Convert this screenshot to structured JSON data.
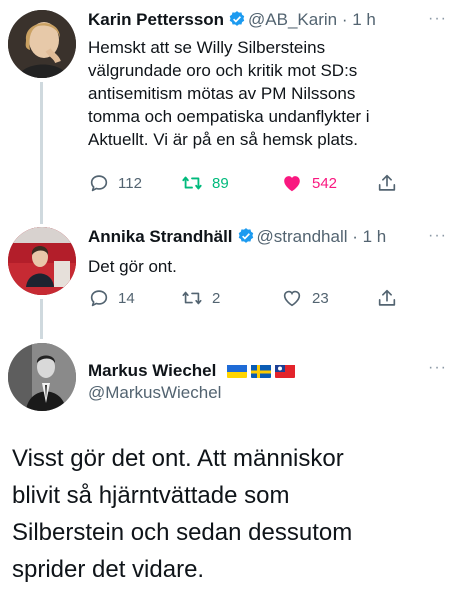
{
  "tweets": [
    {
      "name": "Karin Pettersson",
      "handle": "@AB_Karin",
      "time": "· 1 h",
      "text_lines": [
        "Hemskt att se Willy Silbersteins",
        "välgrundade oro och kritik mot SD:s",
        "antisemitism mötas av PM Nilssons",
        "tomma och oempatiska undanflykter i",
        "Aktuellt. Vi är på en så hemsk plats."
      ],
      "replies": "112",
      "retweets": "89",
      "likes": "542"
    },
    {
      "name": "Annika Strandhäll",
      "handle": "@strandhall",
      "time": "· 1 h",
      "text_lines": [
        "Det gör ont."
      ],
      "replies": "14",
      "retweets": "2",
      "likes": "23"
    },
    {
      "name": "Markus Wiechel",
      "handle": "@MarkusWiechel",
      "flags": [
        "ukraine-flag",
        "sweden-flag",
        "taiwan-flag"
      ],
      "text_lines": [
        "Visst gör det ont. Att människor",
        "blivit så hjärntvättade som",
        "Silberstein och sedan dessutom",
        "sprider det vidare."
      ]
    }
  ],
  "more_label": "···",
  "colors": {
    "like_active": "#f91880",
    "retweet_active": "#00ba7c",
    "verified": "#1d9bf0",
    "muted": "#536471"
  }
}
